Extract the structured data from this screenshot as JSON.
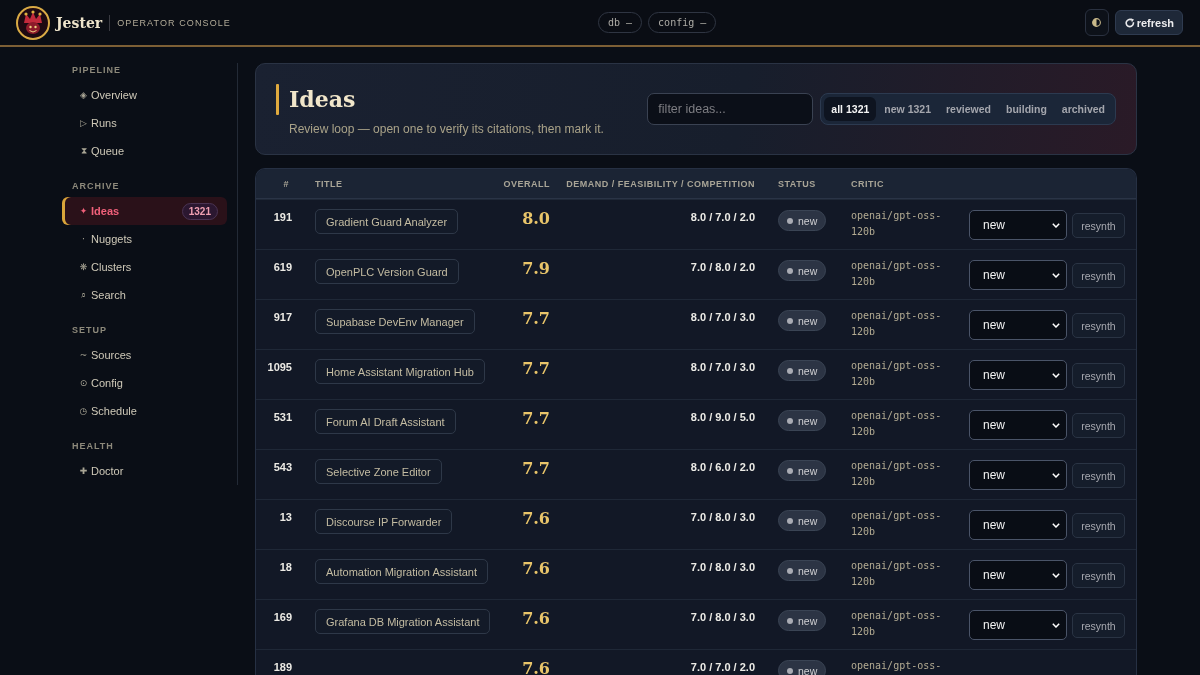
{
  "header": {
    "brand": "Jester",
    "subtitle": "OPERATOR CONSOLE",
    "pills": [
      "db –",
      "config –"
    ],
    "refresh_label": "refresh"
  },
  "sidebar": {
    "sections": [
      {
        "label": "PIPELINE",
        "items": [
          {
            "icon": "◈",
            "label": "Overview",
            "selected": false
          },
          {
            "icon": "▷",
            "label": "Runs",
            "selected": false
          },
          {
            "icon": "⧗",
            "label": "Queue",
            "selected": false
          }
        ]
      },
      {
        "label": "ARCHIVE",
        "items": [
          {
            "icon": "✦",
            "label": "Ideas",
            "count": "1321",
            "selected": true
          },
          {
            "icon": "·",
            "label": "Nuggets",
            "selected": false
          },
          {
            "icon": "❋",
            "label": "Clusters",
            "selected": false
          },
          {
            "icon": "⌕",
            "label": "Search",
            "selected": false
          }
        ]
      },
      {
        "label": "SETUP",
        "items": [
          {
            "icon": "~",
            "label": "Sources",
            "selected": false
          },
          {
            "icon": "⊙",
            "label": "Config",
            "selected": false
          },
          {
            "icon": "◷",
            "label": "Schedule",
            "selected": false
          }
        ]
      },
      {
        "label": "HEALTH",
        "items": [
          {
            "icon": "✚",
            "label": "Doctor",
            "selected": false
          }
        ]
      }
    ]
  },
  "page": {
    "title": "Ideas",
    "subtitle": "Review loop — open one to verify its citations, then mark it.",
    "filter": {
      "placeholder": "filter ideas..."
    },
    "tabs": [
      {
        "label": "all 1321",
        "selected": true
      },
      {
        "label": "new 1321",
        "selected": false
      },
      {
        "label": "reviewed",
        "selected": false
      },
      {
        "label": "building",
        "selected": false
      },
      {
        "label": "archived",
        "selected": false
      }
    ]
  },
  "table": {
    "columns": [
      "#",
      "TITLE",
      "OVERALL",
      "DEMAND / FEASIBILITY / COMPETITION",
      "STATUS",
      "CRITIC"
    ],
    "rows": [
      {
        "num": "191",
        "title": "Gradient Guard Analyzer",
        "overall": "8.0",
        "scores": "8.0 / 7.0 / 2.0",
        "status": "new",
        "critic": "openai/gpt-oss-120b",
        "decision": "new",
        "action": "resynth"
      },
      {
        "num": "619",
        "title": "OpenPLC Version Guard",
        "overall": "7.9",
        "scores": "7.0 / 8.0 / 2.0",
        "status": "new",
        "critic": "openai/gpt-oss-120b",
        "decision": "new",
        "action": "resynth"
      },
      {
        "num": "917",
        "title": "Supabase DevEnv Manager",
        "overall": "7.7",
        "scores": "8.0 / 7.0 / 3.0",
        "status": "new",
        "critic": "openai/gpt-oss-120b",
        "decision": "new",
        "action": "resynth"
      },
      {
        "num": "1095",
        "title": "Home Assistant Migration Hub",
        "overall": "7.7",
        "scores": "8.0 / 7.0 / 3.0",
        "status": "new",
        "critic": "openai/gpt-oss-120b",
        "decision": "new",
        "action": "resynth"
      },
      {
        "num": "531",
        "title": "Forum AI Draft Assistant",
        "overall": "7.7",
        "scores": "8.0 / 9.0 / 5.0",
        "status": "new",
        "critic": "openai/gpt-oss-120b",
        "decision": "new",
        "action": "resynth"
      },
      {
        "num": "543",
        "title": "Selective Zone Editor",
        "overall": "7.7",
        "scores": "8.0 / 6.0 / 2.0",
        "status": "new",
        "critic": "openai/gpt-oss-120b",
        "decision": "new",
        "action": "resynth"
      },
      {
        "num": "13",
        "title": "Discourse IP Forwarder",
        "overall": "7.6",
        "scores": "7.0 / 8.0 / 3.0",
        "status": "new",
        "critic": "openai/gpt-oss-120b",
        "decision": "new",
        "action": "resynth"
      },
      {
        "num": "18",
        "title": "Automation Migration Assistant",
        "overall": "7.6",
        "scores": "7.0 / 8.0 / 3.0",
        "status": "new",
        "critic": "openai/gpt-oss-120b",
        "decision": "new",
        "action": "resynth"
      },
      {
        "num": "169",
        "title": "Grafana DB Migration Assistant",
        "overall": "7.6",
        "scores": "7.0 / 8.0 / 3.0",
        "status": "new",
        "critic": "openai/gpt-oss-120b",
        "decision": "new",
        "action": "resynth"
      },
      {
        "num": "189",
        "overall": "7.6",
        "scores": "7.0 / 7.0 / 2.0",
        "status": "new",
        "critic": "openai/gpt-oss-"
      }
    ]
  }
}
